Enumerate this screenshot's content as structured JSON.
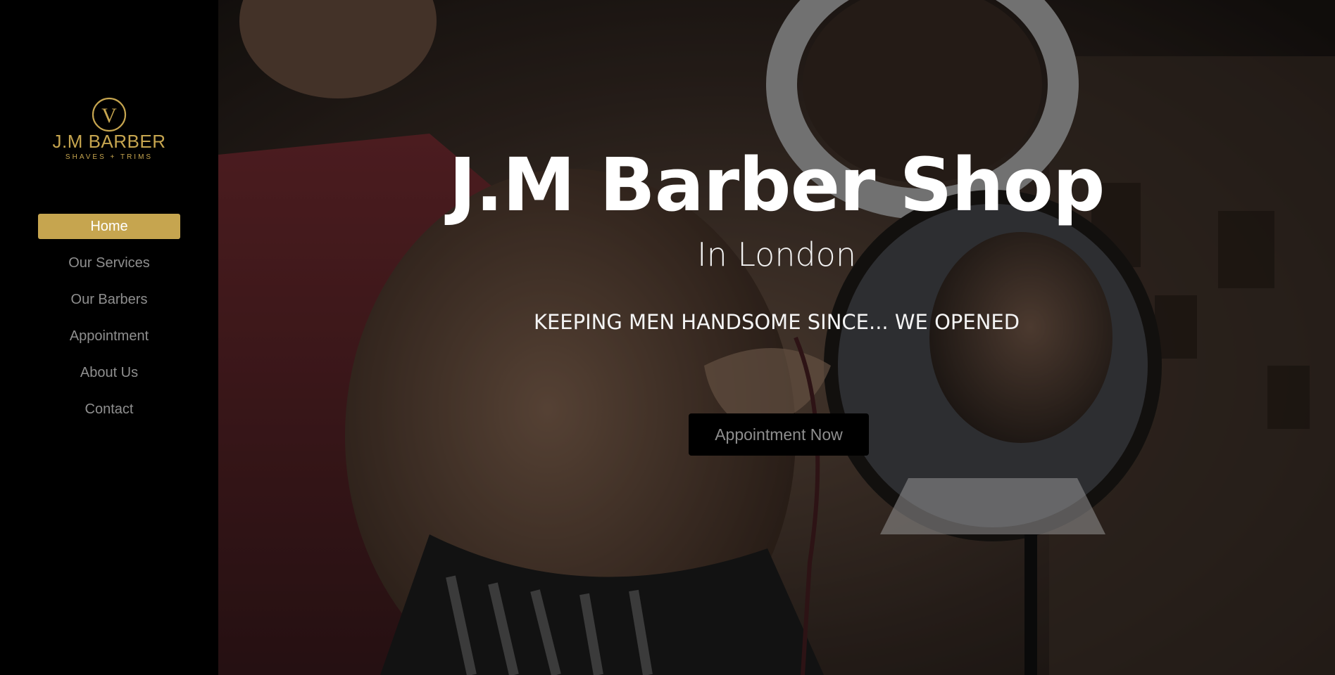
{
  "brand": {
    "logo_initial": "V",
    "logo_name": "J.M BARBER",
    "logo_tagline": "SHAVES + TRIMS",
    "accent_color": "#c6a54f"
  },
  "nav": {
    "items": [
      {
        "label": "Home",
        "active": true
      },
      {
        "label": "Our Services",
        "active": false
      },
      {
        "label": "Our Barbers",
        "active": false
      },
      {
        "label": "Appointment",
        "active": false
      },
      {
        "label": "About Us",
        "active": false
      },
      {
        "label": "Contact",
        "active": false
      }
    ]
  },
  "hero": {
    "title": "J.M Barber Shop",
    "subtitle": "In London",
    "tagline": "KEEPING MEN HANDSOME SINCE... WE OPENED",
    "button_label": "Appointment Now",
    "background": "photo of a barber trimming a man's hair in front of a round mirror"
  }
}
